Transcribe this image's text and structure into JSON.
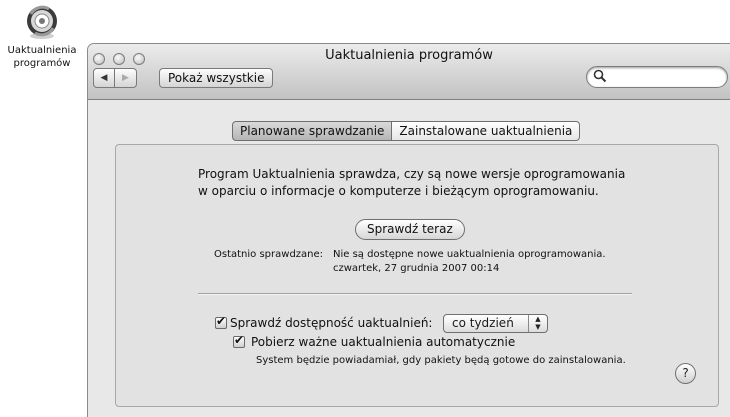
{
  "desktop_icon": {
    "label_line1": "Uaktualnienia",
    "label_line2": "programów",
    "icon": "software-update-icon"
  },
  "window": {
    "title": "Uaktualnienia programów",
    "show_all_label": "Pokaż wszystkie",
    "search_placeholder": "",
    "icons": {
      "back": "back-arrow-icon",
      "forward": "forward-arrow-icon",
      "search": "magnifier-icon"
    }
  },
  "tabs": [
    {
      "label": "Planowane sprawdzanie",
      "selected": true
    },
    {
      "label": "Zainstalowane uaktualnienia",
      "selected": false
    }
  ],
  "scheduled": {
    "description_line1": "Program Uaktualnienia sprawdza, czy są nowe wersje oprogramowania",
    "description_line2": "w oparciu o informacje o komputerze i bieżącym oprogramowaniu.",
    "check_now_label": "Sprawdź teraz",
    "last_checked_label": "Ostatnio sprawdzane:",
    "last_checked_result": "Nie są dostępne nowe uaktualnienia oprogramowania.",
    "last_checked_date": "czwartek, 27 grudnia 2007 00:14",
    "check_for_updates_label": "Sprawdź dostępność uaktualnień:",
    "check_for_updates_checked": true,
    "frequency_value": "co tydzień",
    "download_label": "Pobierz ważne uaktualnienia automatycznie",
    "download_checked": true,
    "download_note": "System będzie powiadamiał, gdy pakiety będą gotowe do zainstalowania.",
    "help_label": "?"
  }
}
